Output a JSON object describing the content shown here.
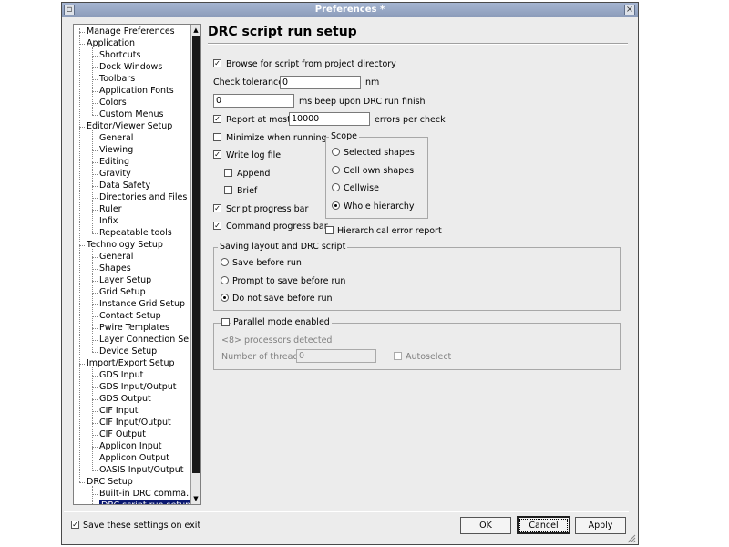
{
  "window": {
    "title": "Preferences *"
  },
  "tree": {
    "items": [
      {
        "label": "Manage Preferences",
        "level": 0
      },
      {
        "label": "Application",
        "level": 0
      },
      {
        "label": "Shortcuts",
        "level": 1
      },
      {
        "label": "Dock Windows",
        "level": 1
      },
      {
        "label": "Toolbars",
        "level": 1
      },
      {
        "label": "Application Fonts",
        "level": 1
      },
      {
        "label": "Colors",
        "level": 1
      },
      {
        "label": "Custom Menus",
        "level": 1
      },
      {
        "label": "Editor/Viewer Setup",
        "level": 0
      },
      {
        "label": "General",
        "level": 1
      },
      {
        "label": "Viewing",
        "level": 1
      },
      {
        "label": "Editing",
        "level": 1
      },
      {
        "label": "Gravity",
        "level": 1
      },
      {
        "label": "Data Safety",
        "level": 1
      },
      {
        "label": "Directories and Files",
        "level": 1
      },
      {
        "label": "Ruler",
        "level": 1
      },
      {
        "label": "Infix",
        "level": 1
      },
      {
        "label": "Repeatable tools",
        "level": 1
      },
      {
        "label": "Technology Setup",
        "level": 0
      },
      {
        "label": "General",
        "level": 1
      },
      {
        "label": "Shapes",
        "level": 1
      },
      {
        "label": "Layer Setup",
        "level": 1
      },
      {
        "label": "Grid Setup",
        "level": 1
      },
      {
        "label": "Instance Grid Setup",
        "level": 1
      },
      {
        "label": "Contact Setup",
        "level": 1
      },
      {
        "label": "Pwire Templates",
        "level": 1
      },
      {
        "label": "Layer Connection Se...",
        "level": 1
      },
      {
        "label": "Device Setup",
        "level": 1
      },
      {
        "label": "Import/Export Setup",
        "level": 0
      },
      {
        "label": "GDS Input",
        "level": 1
      },
      {
        "label": "GDS Input/Output",
        "level": 1
      },
      {
        "label": "GDS Output",
        "level": 1
      },
      {
        "label": "CIF Input",
        "level": 1
      },
      {
        "label": "CIF Input/Output",
        "level": 1
      },
      {
        "label": "CIF Output",
        "level": 1
      },
      {
        "label": "Applicon Input",
        "level": 1
      },
      {
        "label": "Applicon Output",
        "level": 1
      },
      {
        "label": "OASIS Input/Output",
        "level": 1
      },
      {
        "label": "DRC Setup",
        "level": 0
      },
      {
        "label": "Built-in DRC comma...",
        "level": 1
      },
      {
        "label": "DRC script run setup",
        "level": 1,
        "selected": true
      }
    ]
  },
  "panel": {
    "heading": "DRC script run setup",
    "browse": {
      "label": "Browse for script from project directory",
      "checked": true
    },
    "tolerance": {
      "label": "Check tolerance",
      "value": "0",
      "unit": "nm"
    },
    "beep": {
      "value": "0",
      "suffix": "ms beep upon DRC run finish"
    },
    "report": {
      "label": "Report at most",
      "value": "10000",
      "suffix": "errors per check",
      "checked": true
    },
    "minimize": {
      "label": "Minimize when running",
      "checked": false
    },
    "writelog": {
      "label": "Write log file",
      "checked": true
    },
    "append": {
      "label": "Append",
      "checked": false
    },
    "brief": {
      "label": "Brief",
      "checked": false
    },
    "script_progress": {
      "label": "Script progress bar",
      "checked": true
    },
    "command_progress": {
      "label": "Command  progress bar",
      "checked": true
    },
    "hier_report": {
      "label": "Hierarchical error report",
      "checked": false
    },
    "scope": {
      "title": "Scope",
      "options": [
        "Selected shapes",
        "Cell own shapes",
        "Cellwise",
        "Whole hierarchy"
      ],
      "selected": "Whole hierarchy"
    },
    "saving": {
      "title": "Saving layout and DRC script",
      "options": [
        "Save before run",
        "Prompt to save before run",
        "Do not save before run"
      ],
      "selected": "Do not save before run"
    },
    "parallel": {
      "label": "Parallel mode enabled",
      "checked": false,
      "detected": "<8> processors detected",
      "threads_label": "Number of threads",
      "threads_value": "0",
      "autoselect": "Autoselect"
    }
  },
  "footer": {
    "save_settings": "Save these settings on exit",
    "save_checked": true,
    "ok": "OK",
    "cancel": "Cancel",
    "apply": "Apply"
  }
}
